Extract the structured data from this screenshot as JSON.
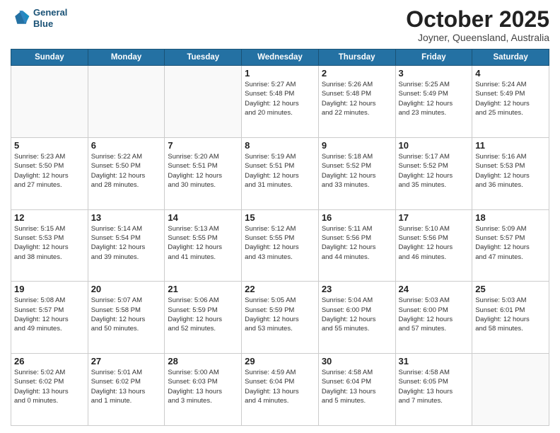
{
  "header": {
    "logo_line1": "General",
    "logo_line2": "Blue",
    "month": "October 2025",
    "location": "Joyner, Queensland, Australia"
  },
  "weekdays": [
    "Sunday",
    "Monday",
    "Tuesday",
    "Wednesday",
    "Thursday",
    "Friday",
    "Saturday"
  ],
  "weeks": [
    [
      {
        "num": "",
        "info": ""
      },
      {
        "num": "",
        "info": ""
      },
      {
        "num": "",
        "info": ""
      },
      {
        "num": "1",
        "info": "Sunrise: 5:27 AM\nSunset: 5:48 PM\nDaylight: 12 hours\nand 20 minutes."
      },
      {
        "num": "2",
        "info": "Sunrise: 5:26 AM\nSunset: 5:48 PM\nDaylight: 12 hours\nand 22 minutes."
      },
      {
        "num": "3",
        "info": "Sunrise: 5:25 AM\nSunset: 5:49 PM\nDaylight: 12 hours\nand 23 minutes."
      },
      {
        "num": "4",
        "info": "Sunrise: 5:24 AM\nSunset: 5:49 PM\nDaylight: 12 hours\nand 25 minutes."
      }
    ],
    [
      {
        "num": "5",
        "info": "Sunrise: 5:23 AM\nSunset: 5:50 PM\nDaylight: 12 hours\nand 27 minutes."
      },
      {
        "num": "6",
        "info": "Sunrise: 5:22 AM\nSunset: 5:50 PM\nDaylight: 12 hours\nand 28 minutes."
      },
      {
        "num": "7",
        "info": "Sunrise: 5:20 AM\nSunset: 5:51 PM\nDaylight: 12 hours\nand 30 minutes."
      },
      {
        "num": "8",
        "info": "Sunrise: 5:19 AM\nSunset: 5:51 PM\nDaylight: 12 hours\nand 31 minutes."
      },
      {
        "num": "9",
        "info": "Sunrise: 5:18 AM\nSunset: 5:52 PM\nDaylight: 12 hours\nand 33 minutes."
      },
      {
        "num": "10",
        "info": "Sunrise: 5:17 AM\nSunset: 5:52 PM\nDaylight: 12 hours\nand 35 minutes."
      },
      {
        "num": "11",
        "info": "Sunrise: 5:16 AM\nSunset: 5:53 PM\nDaylight: 12 hours\nand 36 minutes."
      }
    ],
    [
      {
        "num": "12",
        "info": "Sunrise: 5:15 AM\nSunset: 5:53 PM\nDaylight: 12 hours\nand 38 minutes."
      },
      {
        "num": "13",
        "info": "Sunrise: 5:14 AM\nSunset: 5:54 PM\nDaylight: 12 hours\nand 39 minutes."
      },
      {
        "num": "14",
        "info": "Sunrise: 5:13 AM\nSunset: 5:55 PM\nDaylight: 12 hours\nand 41 minutes."
      },
      {
        "num": "15",
        "info": "Sunrise: 5:12 AM\nSunset: 5:55 PM\nDaylight: 12 hours\nand 43 minutes."
      },
      {
        "num": "16",
        "info": "Sunrise: 5:11 AM\nSunset: 5:56 PM\nDaylight: 12 hours\nand 44 minutes."
      },
      {
        "num": "17",
        "info": "Sunrise: 5:10 AM\nSunset: 5:56 PM\nDaylight: 12 hours\nand 46 minutes."
      },
      {
        "num": "18",
        "info": "Sunrise: 5:09 AM\nSunset: 5:57 PM\nDaylight: 12 hours\nand 47 minutes."
      }
    ],
    [
      {
        "num": "19",
        "info": "Sunrise: 5:08 AM\nSunset: 5:57 PM\nDaylight: 12 hours\nand 49 minutes."
      },
      {
        "num": "20",
        "info": "Sunrise: 5:07 AM\nSunset: 5:58 PM\nDaylight: 12 hours\nand 50 minutes."
      },
      {
        "num": "21",
        "info": "Sunrise: 5:06 AM\nSunset: 5:59 PM\nDaylight: 12 hours\nand 52 minutes."
      },
      {
        "num": "22",
        "info": "Sunrise: 5:05 AM\nSunset: 5:59 PM\nDaylight: 12 hours\nand 53 minutes."
      },
      {
        "num": "23",
        "info": "Sunrise: 5:04 AM\nSunset: 6:00 PM\nDaylight: 12 hours\nand 55 minutes."
      },
      {
        "num": "24",
        "info": "Sunrise: 5:03 AM\nSunset: 6:00 PM\nDaylight: 12 hours\nand 57 minutes."
      },
      {
        "num": "25",
        "info": "Sunrise: 5:03 AM\nSunset: 6:01 PM\nDaylight: 12 hours\nand 58 minutes."
      }
    ],
    [
      {
        "num": "26",
        "info": "Sunrise: 5:02 AM\nSunset: 6:02 PM\nDaylight: 13 hours\nand 0 minutes."
      },
      {
        "num": "27",
        "info": "Sunrise: 5:01 AM\nSunset: 6:02 PM\nDaylight: 13 hours\nand 1 minute."
      },
      {
        "num": "28",
        "info": "Sunrise: 5:00 AM\nSunset: 6:03 PM\nDaylight: 13 hours\nand 3 minutes."
      },
      {
        "num": "29",
        "info": "Sunrise: 4:59 AM\nSunset: 6:04 PM\nDaylight: 13 hours\nand 4 minutes."
      },
      {
        "num": "30",
        "info": "Sunrise: 4:58 AM\nSunset: 6:04 PM\nDaylight: 13 hours\nand 5 minutes."
      },
      {
        "num": "31",
        "info": "Sunrise: 4:58 AM\nSunset: 6:05 PM\nDaylight: 13 hours\nand 7 minutes."
      },
      {
        "num": "",
        "info": ""
      }
    ]
  ]
}
